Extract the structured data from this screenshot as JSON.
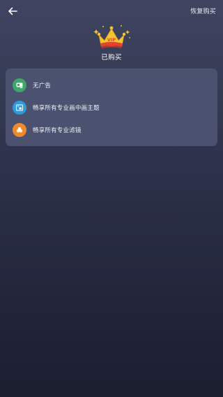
{
  "header": {
    "back_icon": "arrow-left-icon",
    "restore_label": "恢复购买"
  },
  "badge": {
    "icon": "vip-crown-icon",
    "crown_text": "VIP",
    "status_label": "已购买"
  },
  "benefits": [
    {
      "icon": "no-ads-icon",
      "label": "无广告",
      "color": "#3fa56b"
    },
    {
      "icon": "picture-in-picture-theme-icon",
      "label": "畅享所有专业画中画主题",
      "color": "#2d9bdc"
    },
    {
      "icon": "filter-icon",
      "label": "畅享所有专业滤镜",
      "color": "#f0892c"
    }
  ],
  "colors": {
    "background_top": "#3f4561",
    "background_bottom": "#1b1e2f",
    "card": "#4a5270",
    "crown_gold": "#f5c431",
    "crown_red": "#e2452f"
  }
}
